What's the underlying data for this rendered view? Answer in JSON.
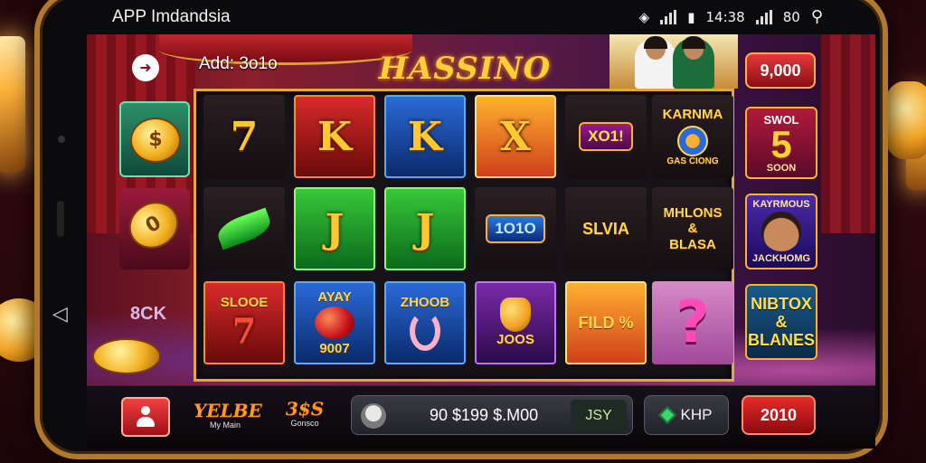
{
  "status_bar": {
    "app_title": "APP Imdandsia",
    "time": "14:38",
    "battery": "80"
  },
  "header": {
    "add_label": "Add: 3o1o",
    "logo": "HASSINO",
    "top_balance": "9,000"
  },
  "side": {
    "bottom_text": "8CK"
  },
  "reels": [
    [
      {
        "kind": "glyph",
        "text": "7",
        "bg": "dark"
      },
      {
        "kind": "leaf",
        "text": "",
        "bg": "dark"
      },
      {
        "kind": "glyph-word",
        "text": "SLOOE",
        "sub": "7",
        "bg": "red"
      }
    ],
    [
      {
        "kind": "glyph",
        "text": "K",
        "bg": "red"
      },
      {
        "kind": "glyph",
        "text": "J",
        "bg": "green"
      },
      {
        "kind": "word-img",
        "text": "AYAY",
        "sub": "9007",
        "img": "apple",
        "bg": "blue"
      }
    ],
    [
      {
        "kind": "glyph",
        "text": "K",
        "bg": "blue"
      },
      {
        "kind": "glyph",
        "text": "J",
        "bg": "green"
      },
      {
        "kind": "word-img",
        "text": "ZHOOB",
        "sub": "",
        "img": "fish",
        "bg": "blue"
      }
    ],
    [
      {
        "kind": "glyph",
        "text": "X",
        "bg": "orange"
      },
      {
        "kind": "pill-blue",
        "text": "1O1O",
        "bg": "dark"
      },
      {
        "kind": "word-img",
        "text": "",
        "sub": "JOOS",
        "img": "fruit",
        "bg": "purple"
      }
    ],
    [
      {
        "kind": "pill",
        "text": "XO1!",
        "bg": "dark"
      },
      {
        "kind": "word",
        "text": "SLVIA",
        "bg": "dark"
      },
      {
        "kind": "word",
        "text": "FILD %",
        "bg": "orange"
      }
    ],
    [
      {
        "kind": "badge",
        "text": "KARNMA",
        "sub": "GAS CIONG",
        "bg": "dark"
      },
      {
        "kind": "word3",
        "text": "MHLONS",
        "mid": "&",
        "sub": "BLASA",
        "bg": "dark"
      },
      {
        "kind": "question",
        "text": "?",
        "bg": "pink"
      }
    ]
  ],
  "right_column": {
    "r1": {
      "top": "SWOL",
      "big": "5",
      "bottom": "SOON"
    },
    "r2": {
      "top": "KAYRMOUS",
      "bottom": "JACKHOMG"
    },
    "r3": {
      "line1": "NIBTOX",
      "line2": "&",
      "line3": "BLANES"
    }
  },
  "bottom_bar": {
    "logo_a": {
      "title": "YELBE",
      "sub": "My Main"
    },
    "logo_b": {
      "title": "3$S",
      "sub": "Gonsco"
    },
    "wallet_amount": "90 $199 $.M00",
    "wallet_currency": "JSY",
    "khp_label": "KHP",
    "spin_value": "2010"
  },
  "colors": {
    "accent_gold": "#e2a83a",
    "accent_red": "#e82a2a",
    "bg_deep": "#3a0c12"
  }
}
